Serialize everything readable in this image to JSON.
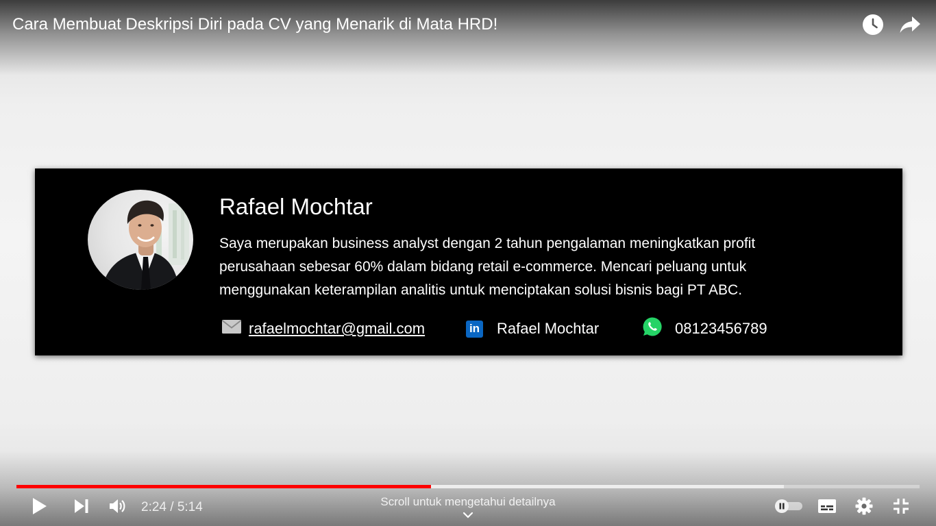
{
  "video": {
    "title": "Cara Membuat Deskripsi Diri pada CV yang Menarik di Mata HRD!",
    "top_icons": [
      "watch-later-icon",
      "share-icon"
    ]
  },
  "cv": {
    "name": "Rafael Mochtar",
    "description_lines": [
      "Saya merupakan business analyst dengan 2 tahun pengalaman meningkatkan profit",
      "perusahaan sebesar 60% dalam bidang retail e-commerce. Mencari peluang untuk",
      "menggunakan keterampilan analitis untuk menciptakan solusi bisnis bagi PT ABC."
    ],
    "contacts": {
      "email": "rafaelmochtar@gmail.com",
      "linkedin_badge": "in",
      "linkedin": "Rafael Mochtar",
      "phone": "08123456789"
    }
  },
  "player": {
    "current_time": "2:24",
    "duration": "5:14",
    "time_display": "2:24 / 5:14",
    "played_fraction": 0.459,
    "buffered_fraction": 0.85,
    "scroll_hint": "Scroll untuk mengetahui detailnya",
    "progress_color": "#ff0000",
    "icons": [
      "play-icon",
      "next-icon",
      "volume-icon",
      "autoplay-toggle-icon",
      "subtitles-icon",
      "settings-icon",
      "exit-fullscreen-icon",
      "chevron-down-icon"
    ]
  }
}
